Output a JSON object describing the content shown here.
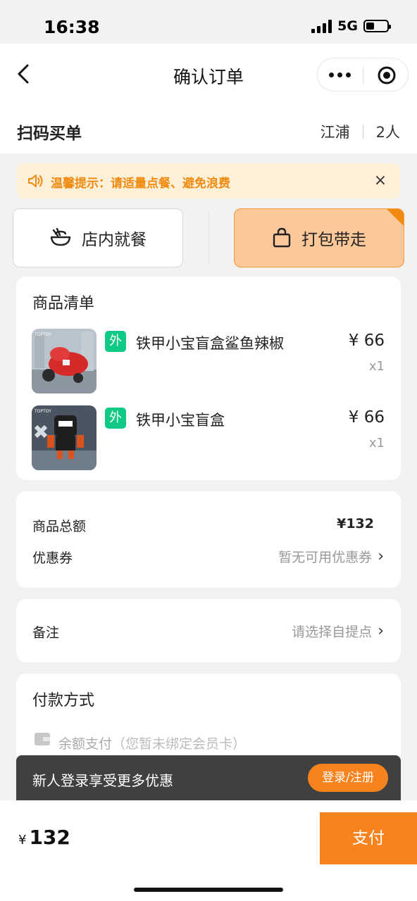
{
  "status_bar": {
    "time": "16:38",
    "network": "5G"
  },
  "nav": {
    "title": "确认订单"
  },
  "header": {
    "title": "扫码买单",
    "store": "江浦",
    "people": "2人"
  },
  "tip": {
    "text": "温馨提示：请适量点餐、避免浪费",
    "close": "×"
  },
  "modes": {
    "dine_in": "店内就餐",
    "takeaway": "打包带走",
    "selected": "takeaway"
  },
  "items_card": {
    "title": "商品清单",
    "items": [
      {
        "tag": "外",
        "name": "铁甲小宝盲盒鲨鱼辣椒",
        "price": "¥ 66",
        "qty": "x1"
      },
      {
        "tag": "外",
        "name": "铁甲小宝盲盒",
        "price": "¥ 66",
        "qty": "x1"
      }
    ]
  },
  "summary": {
    "total_label": "商品总额",
    "total_value": "¥132",
    "coupon_label": "优惠券",
    "coupon_value": "暂无可用优惠券"
  },
  "remark": {
    "label": "备注",
    "value": "请选择自提点"
  },
  "payment": {
    "title": "付款方式",
    "balance_label": "余额支付",
    "balance_note": "（您暂未绑定会员卡）"
  },
  "login_banner": {
    "text": "新人登录享受更多优惠",
    "button": "登录/注册"
  },
  "bottom": {
    "currency": "¥",
    "amount": "132",
    "pay_button": "支付"
  },
  "colors": {
    "accent": "#f7831e",
    "tag_green": "#10c985",
    "tip_bg": "#fdf0d9"
  }
}
